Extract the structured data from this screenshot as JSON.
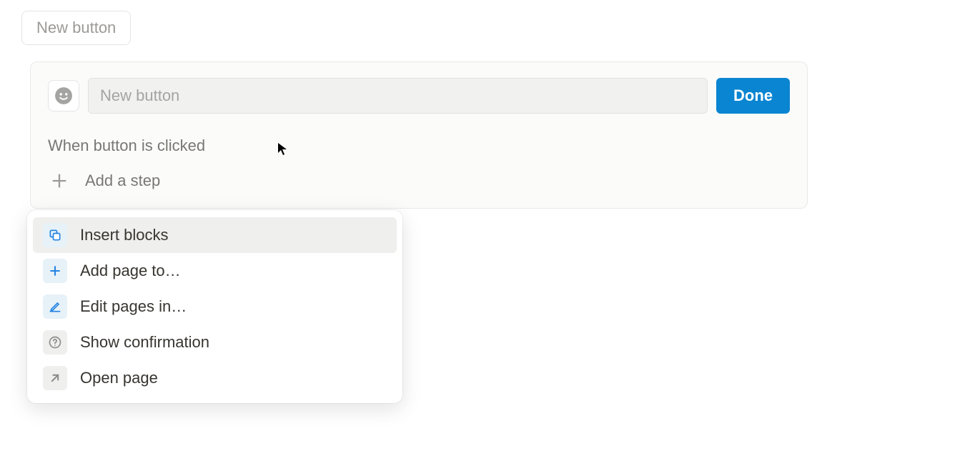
{
  "toolbar": {
    "new_button_label": "New button"
  },
  "panel": {
    "name_placeholder": "New button",
    "name_value": "",
    "done_label": "Done",
    "section_heading": "When button is clicked",
    "add_step_label": "Add a step"
  },
  "dropdown": {
    "items": [
      {
        "icon": "insert-blocks-icon",
        "label": "Insert blocks",
        "selected": true
      },
      {
        "icon": "plus-icon",
        "label": "Add page to…",
        "selected": false
      },
      {
        "icon": "edit-icon",
        "label": "Edit pages in…",
        "selected": false
      },
      {
        "icon": "question-icon",
        "label": "Show confirmation",
        "selected": false
      },
      {
        "icon": "open-page-icon",
        "label": "Open page",
        "selected": false
      }
    ]
  }
}
